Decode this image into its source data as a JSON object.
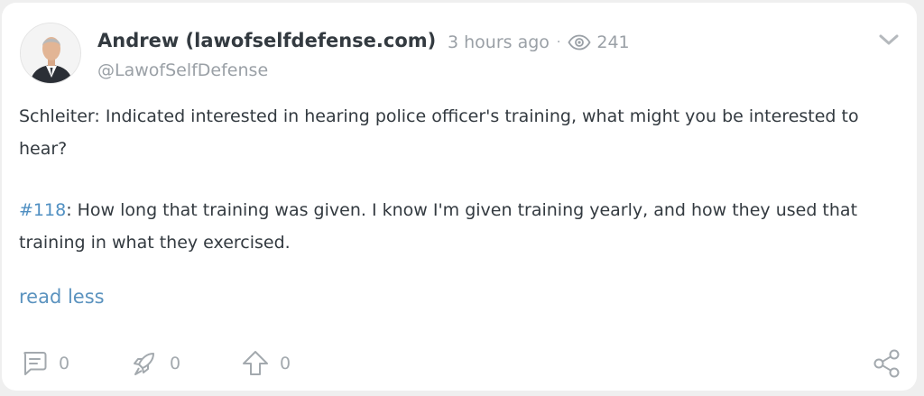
{
  "post": {
    "author_name": "Andrew (lawofselfdefense.com)",
    "time_ago": "3 hours ago",
    "separator": "·",
    "view_count": "241",
    "handle": "@LawofSelfDefense",
    "paragraph1": "Schleiter: Indicated interested in hearing police officer's training, what might you be interested to hear?",
    "paragraph2_tag": "#118",
    "paragraph2_text": ": How long that training was given. I know I'm given training yearly, and how they used that training in what they exercised.",
    "read_less_label": "read less"
  },
  "actions": {
    "comments": "0",
    "boosts": "0",
    "upvotes": "0"
  },
  "icons": {
    "views": "eye-icon",
    "menu": "chevron-down-icon",
    "comment": "comment-icon",
    "boost": "rocket-icon",
    "upvote": "arrow-up-icon",
    "share": "share-icon"
  },
  "colors": {
    "text": "#333a40",
    "muted": "#9aa0a6",
    "link": "#5b93bf",
    "card": "#ffffff",
    "background": "#efefef"
  }
}
